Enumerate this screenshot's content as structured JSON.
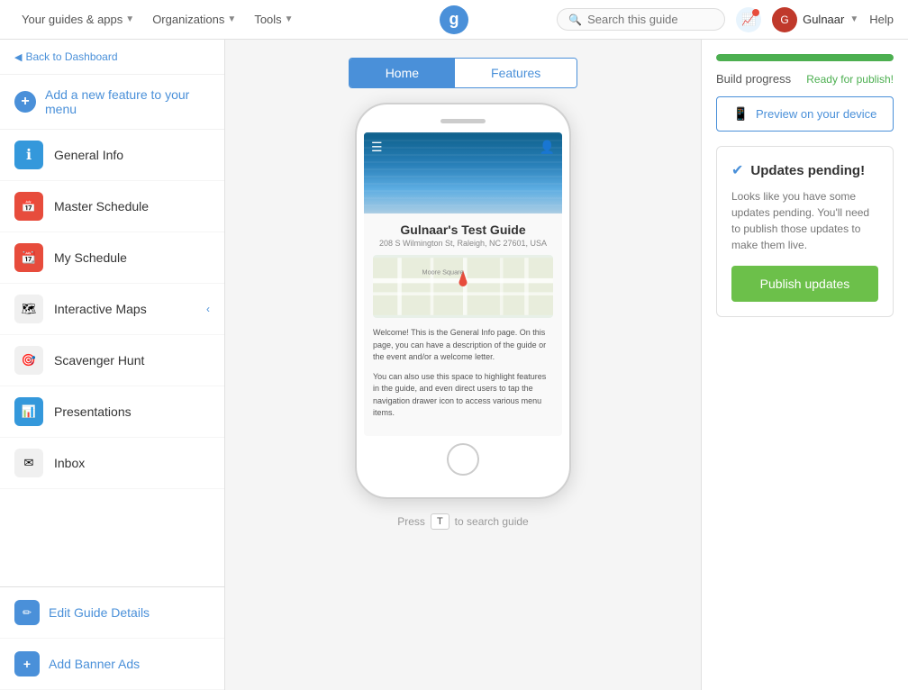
{
  "topnav": {
    "guides_label": "Your guides & apps",
    "orgs_label": "Organizations",
    "tools_label": "Tools",
    "logo_letter": "g",
    "search_placeholder": "Search this guide",
    "user_name": "Gulnaar",
    "help_label": "Help"
  },
  "sidebar": {
    "back_label": "Back to Dashboard",
    "add_feature_label": "Add a new feature to your menu",
    "items": [
      {
        "label": "General Info",
        "icon": "ℹ"
      },
      {
        "label": "Master Schedule",
        "icon": "📅"
      },
      {
        "label": "My Schedule",
        "icon": "📆"
      },
      {
        "label": "Interactive Maps",
        "icon": "🗺"
      },
      {
        "label": "Scavenger Hunt",
        "icon": "🎯"
      },
      {
        "label": "Presentations",
        "icon": "📊"
      },
      {
        "label": "Inbox",
        "icon": "✉"
      }
    ],
    "bottom_items": [
      {
        "label": "Edit Guide Details",
        "icon": "✏"
      },
      {
        "label": "Add Banner Ads",
        "icon": "+"
      }
    ]
  },
  "preview": {
    "tabs": [
      {
        "label": "Home"
      },
      {
        "label": "Features"
      }
    ],
    "active_tab": 0,
    "phone": {
      "guide_title": "Gulnaar's Test Guide",
      "address": "208 S Wilmington St, Raleigh, NC 27601, USA",
      "welcome_text_1": "Welcome! This is the General Info page. On this page, you can have a description of the guide or the event and/or a welcome letter.",
      "welcome_text_2": "You can also use this space to highlight features in the guide, and even direct users to tap the navigation drawer icon to access various menu items."
    },
    "search_hint": {
      "press_label": "Press",
      "key": "T",
      "to_search": "to search guide"
    }
  },
  "right_panel": {
    "build_progress_label": "Build progress",
    "ready_text": "Ready for publish!",
    "preview_btn_label": "Preview on your device",
    "progress_percent": 100,
    "updates_card": {
      "title": "Updates pending!",
      "description": "Looks like you have some updates pending. You'll need to publish those updates to make them live.",
      "publish_btn_label": "Publish updates"
    }
  }
}
